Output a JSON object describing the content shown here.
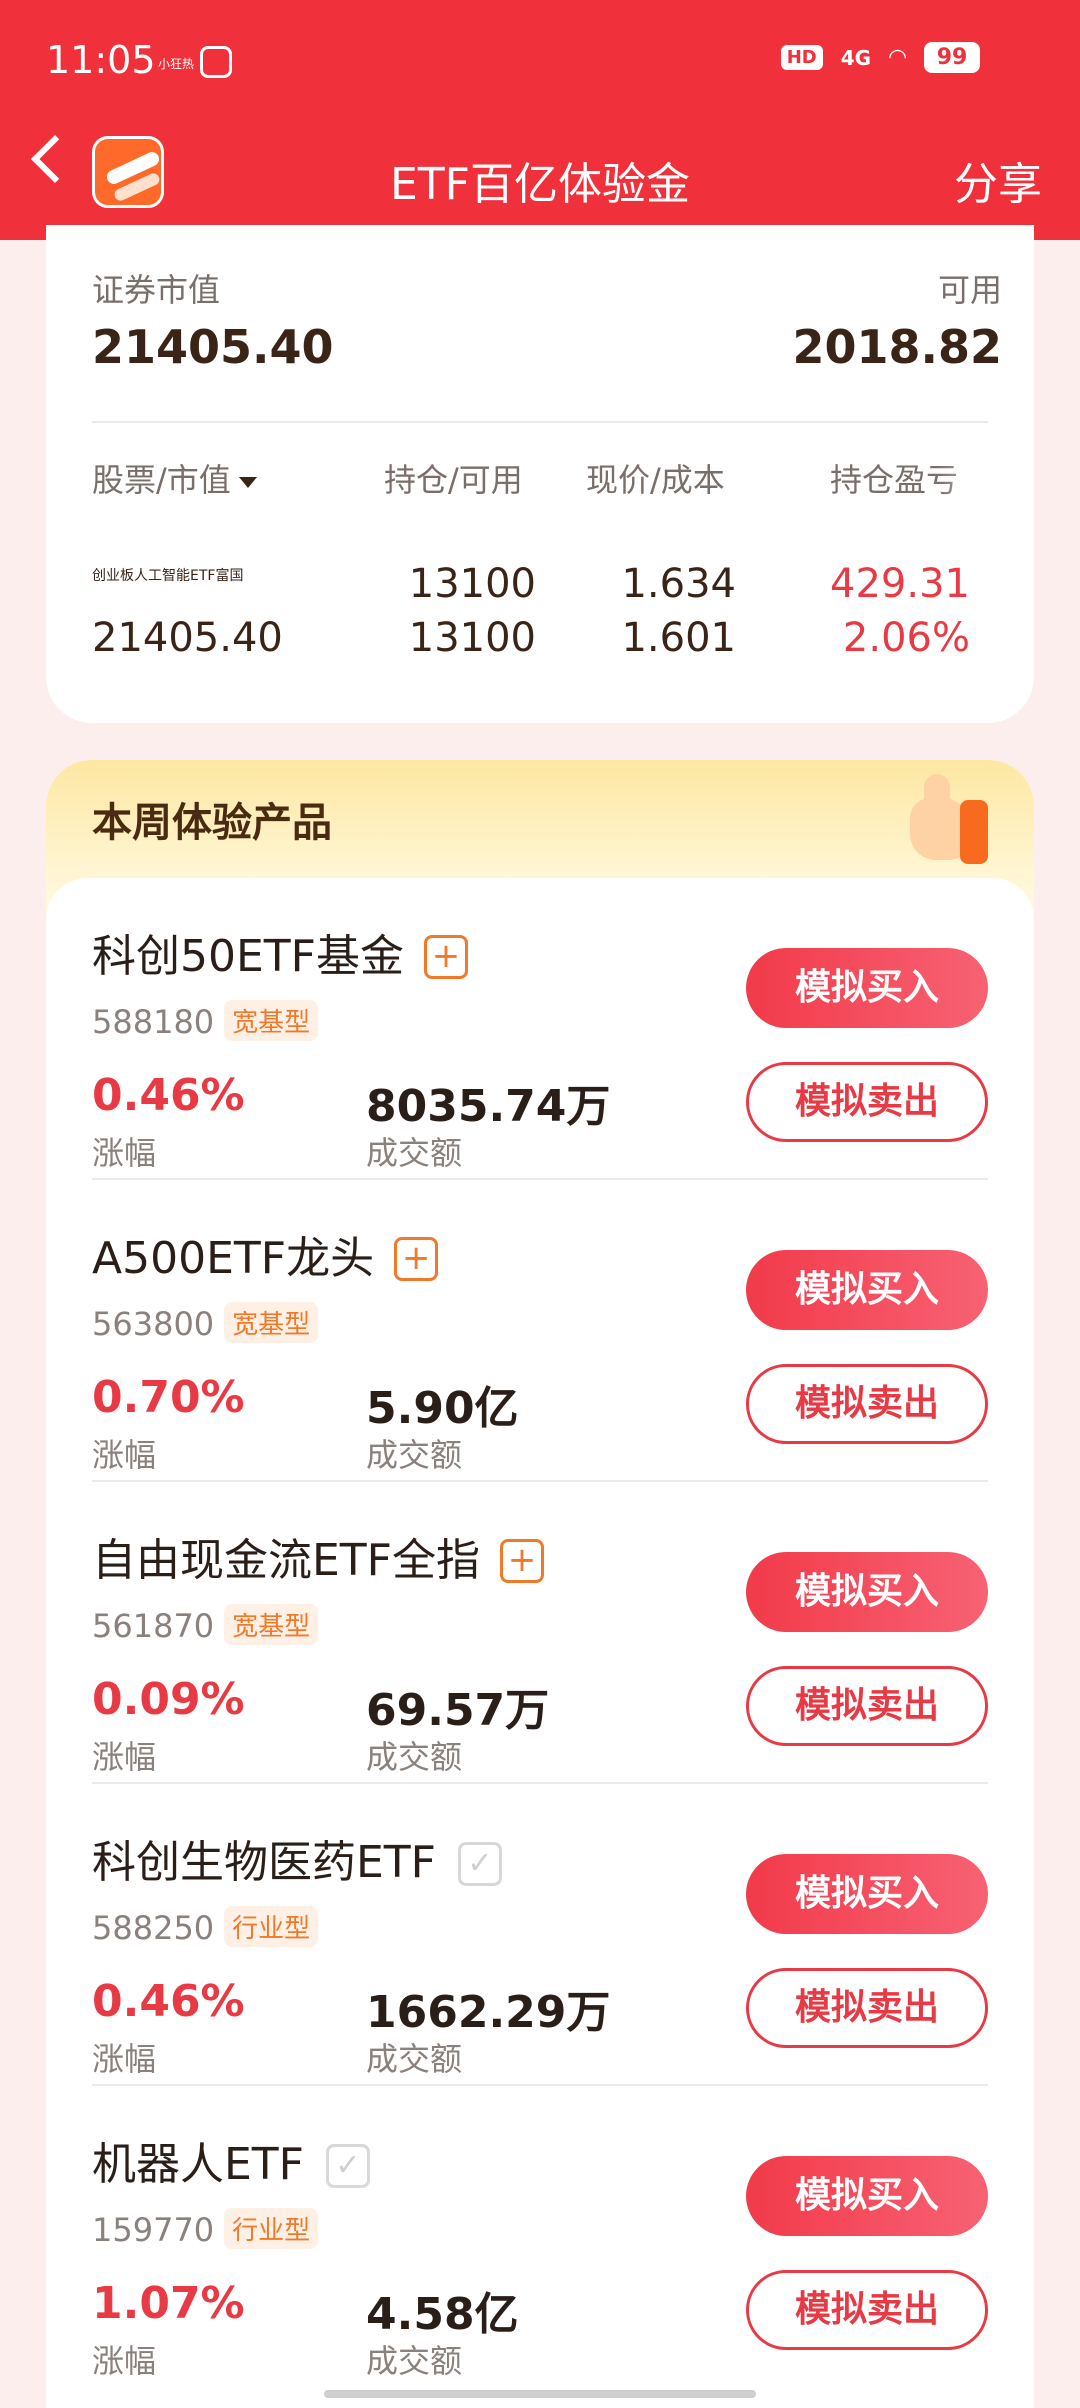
{
  "status": {
    "time": "11:05",
    "mini_text": "小狂热",
    "hd": "HD",
    "network": "4G",
    "battery": "99"
  },
  "header": {
    "title": "ETF百亿体验金",
    "share": "分享"
  },
  "account": {
    "market_value_label": "证券市值",
    "market_value": "21405.40",
    "available_label": "可用",
    "available": "2018.82"
  },
  "holdings": {
    "columns": [
      "股票/市值",
      "持仓/可用",
      "现价/成本",
      "持仓盈亏"
    ],
    "rows": [
      {
        "name": "创业板人工智能ETF富国",
        "market_value": "21405.40",
        "position": "13100",
        "available": "13100",
        "price": "1.634",
        "cost": "1.601",
        "pnl": "429.31",
        "pnl_pct": "2.06%"
      }
    ]
  },
  "section": {
    "title": "本周体验产品"
  },
  "products": [
    {
      "name": "科创50ETF基金",
      "added": false,
      "code": "588180",
      "tag": "宽基型",
      "change": "0.46%",
      "change_label": "涨幅",
      "volume": "8035.74万",
      "volume_label": "成交额",
      "buy": "模拟买入",
      "sell": "模拟卖出"
    },
    {
      "name": "A500ETF龙头",
      "added": false,
      "code": "563800",
      "tag": "宽基型",
      "change": "0.70%",
      "change_label": "涨幅",
      "volume": "5.90亿",
      "volume_label": "成交额",
      "buy": "模拟买入",
      "sell": "模拟卖出"
    },
    {
      "name": "自由现金流ETF全指",
      "added": false,
      "code": "561870",
      "tag": "宽基型",
      "change": "0.09%",
      "change_label": "涨幅",
      "volume": "69.57万",
      "volume_label": "成交额",
      "buy": "模拟买入",
      "sell": "模拟卖出"
    },
    {
      "name": "科创生物医药ETF",
      "added": true,
      "code": "588250",
      "tag": "行业型",
      "change": "0.46%",
      "change_label": "涨幅",
      "volume": "1662.29万",
      "volume_label": "成交额",
      "buy": "模拟买入",
      "sell": "模拟卖出"
    },
    {
      "name": "机器人ETF",
      "added": true,
      "code": "159770",
      "tag": "行业型",
      "change": "1.07%",
      "change_label": "涨幅",
      "volume": "4.58亿",
      "volume_label": "成交额",
      "buy": "模拟买入",
      "sell": "模拟卖出"
    }
  ],
  "icons": {
    "add": "+",
    "added": "✓"
  },
  "colors": {
    "brand_red": "#f0303a",
    "rise_red": "#e83a45",
    "tag_orange": "#f07a2a"
  }
}
